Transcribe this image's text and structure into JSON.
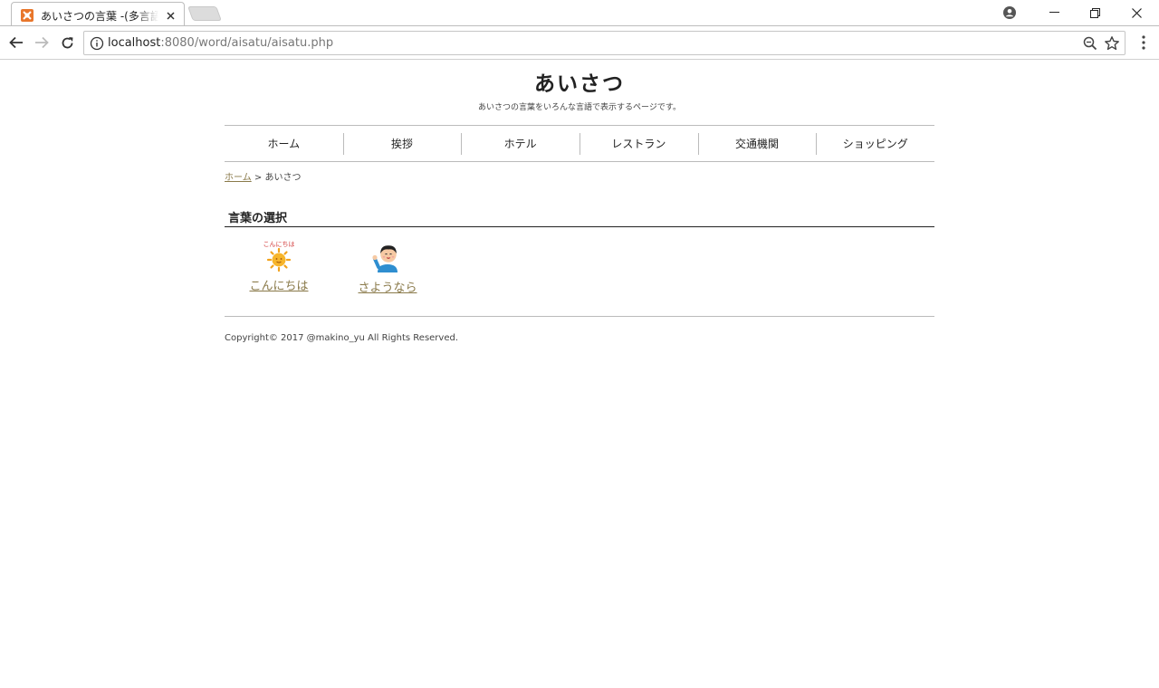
{
  "browser": {
    "tab_title": "あいさつの言葉 -(多言語学",
    "url_host": "localhost",
    "url_rest": ":8080/word/aisatu/aisatu.php"
  },
  "site": {
    "title": "あいさつ",
    "description": "あいさつの言葉をいろんな言語で表示するページです。"
  },
  "nav": {
    "items": [
      {
        "label": "ホーム"
      },
      {
        "label": "挨拶"
      },
      {
        "label": "ホテル"
      },
      {
        "label": "レストラン"
      },
      {
        "label": "交通機関"
      },
      {
        "label": "ショッピング"
      }
    ]
  },
  "breadcrumb": {
    "home": "ホーム",
    "separator": " > ",
    "current": "あいさつ"
  },
  "section": {
    "title": "言葉の選択"
  },
  "words": [
    {
      "label": "こんにちは",
      "icon": "sun-konnichiwa-icon",
      "icon_caption": "こんにちは"
    },
    {
      "label": "さようなら",
      "icon": "waving-boy-icon"
    }
  ],
  "footer": {
    "copyright": "Copyright© 2017 @makino_yu All Rights Reserved."
  },
  "colors": {
    "link": "#8a7a4a",
    "favicon": "#e8762b"
  }
}
